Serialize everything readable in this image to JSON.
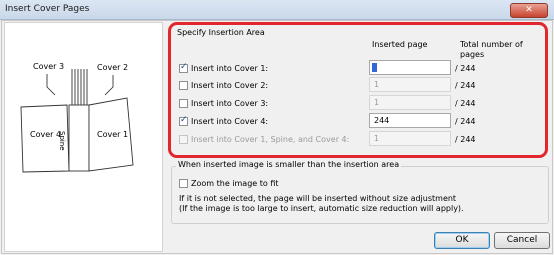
{
  "window": {
    "title": "Insert Cover Pages",
    "close_glyph": "✕"
  },
  "diagram": {
    "cover3": "Cover 3",
    "cover2": "Cover 2",
    "cover4": "Cover 4",
    "cover1": "Cover 1",
    "spine": "Spine"
  },
  "insertion": {
    "section_title": "Specify Insertion Area",
    "col_inserted": "Inserted page",
    "col_total": "Total number of pages",
    "rows": [
      {
        "label": "Insert into Cover 1:",
        "checked": true,
        "enabled": true,
        "value": "",
        "total": "/ 244"
      },
      {
        "label": "Insert into Cover 2:",
        "checked": false,
        "enabled": true,
        "value": "1",
        "total": "/ 244"
      },
      {
        "label": "Insert into Cover 3:",
        "checked": false,
        "enabled": true,
        "value": "1",
        "total": "/ 244"
      },
      {
        "label": "Insert into Cover 4:",
        "checked": true,
        "enabled": true,
        "value": "244",
        "total": "/ 244"
      },
      {
        "label": "Insert into Cover 1, Spine, and Cover 4:",
        "checked": false,
        "enabled": false,
        "value": "1",
        "total": "/ 244"
      }
    ]
  },
  "smaller": {
    "group_title": "When inserted image is smaller than the insertion area",
    "zoom_label": "Zoom the image to fit",
    "note1": "If it is not selected, the page will be inserted without size adjustment",
    "note2": "(If the image is too large to insert, automatic size reduction will apply)."
  },
  "buttons": {
    "ok": "OK",
    "cancel": "Cancel"
  }
}
